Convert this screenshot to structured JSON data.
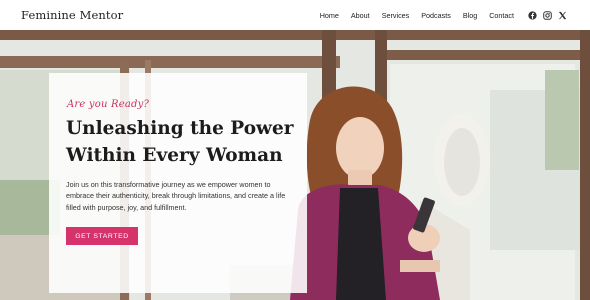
{
  "header": {
    "brand": "Feminine Mentor",
    "nav": [
      "Home",
      "About",
      "Services",
      "Podcasts",
      "Blog",
      "Contact"
    ],
    "social_icons": [
      "facebook-icon",
      "instagram-icon",
      "x-icon"
    ]
  },
  "hero": {
    "eyebrow": "Are you Ready?",
    "title_line1": "Unleashing the Power",
    "title_line2": "Within Every Woman",
    "description": "Join us on this transformative journey as we empower women to embrace their authenticity, break through limitations, and create a life filled with purpose, joy, and fulfillment.",
    "cta_label": "GET STARTED"
  },
  "colors": {
    "accent": "#d6336c",
    "eyebrow": "#c8325e",
    "text": "#1c1c1c"
  }
}
